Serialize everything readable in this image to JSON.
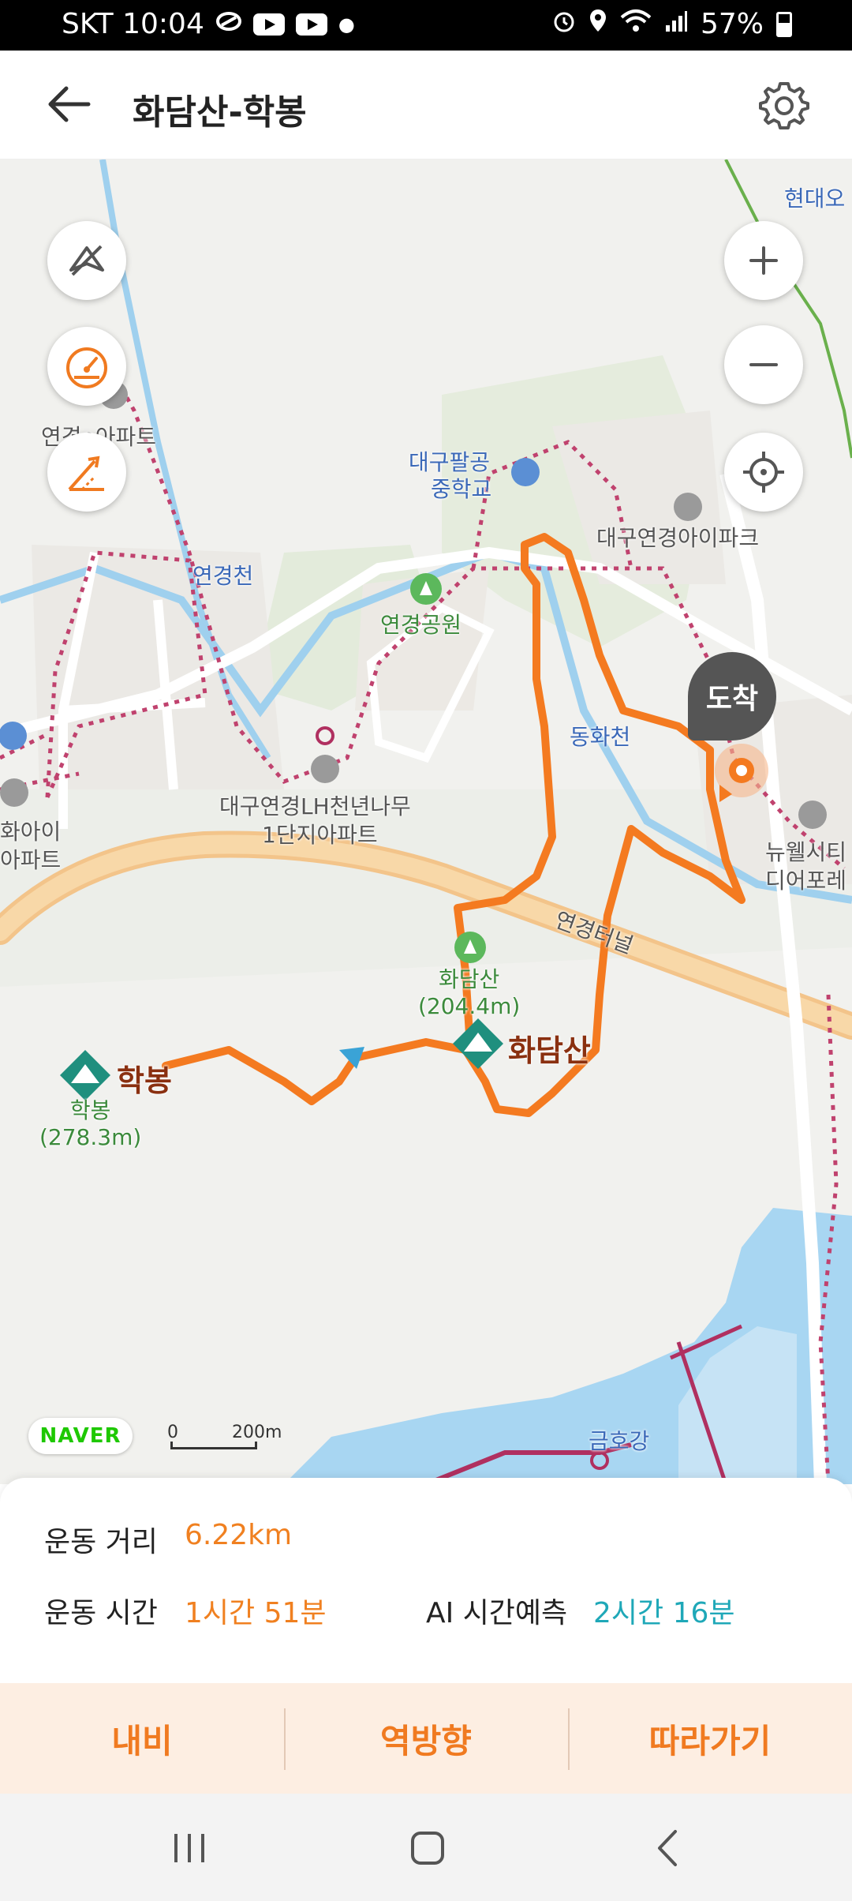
{
  "status_bar": {
    "carrier_time": "SKT 10:04",
    "battery": "57%",
    "icons": [
      "activity-icon",
      "youtube-icon",
      "youtube-icon",
      "dot-icon",
      "alarm-icon",
      "location-icon",
      "wifi-icon",
      "signal-icon",
      "battery-icon"
    ]
  },
  "header": {
    "title": "화담산-학봉",
    "back_icon": "arrow-left-icon",
    "settings_icon": "gear-icon"
  },
  "map": {
    "controls": {
      "left": [
        "route-off-icon",
        "speedometer-icon",
        "elevation-icon"
      ],
      "right": [
        "zoom-in-icon",
        "zoom-out-icon",
        "locate-icon"
      ]
    },
    "labels": {
      "hyundai": "현대오",
      "apt_left": "연경e아파트",
      "daegu_middle_1": "대구팔공",
      "daegu_middle_2": "중학교",
      "ipark": "대구연경아이파크",
      "yeongyeongcheon": "연경천",
      "park": "연경공원",
      "donghwacheon": "동화천",
      "lh_apt_1": "대구연경LH천년나무",
      "lh_apt_2": "1단지아파트",
      "left_apt_1": "화아이",
      "left_apt_2": "아파트",
      "newell_1": "뉴웰시티",
      "newell_2": "디어포레",
      "tunnel": "연경터널",
      "hwadamsan_small": "화담산",
      "hwadamsan_elev": "(204.4m)",
      "hwadamsan_peak": "화담산",
      "hakbong_peak": "학봉",
      "hakbong_small": "학봉",
      "hakbong_elev": "(278.3m)",
      "geumho": "금호강"
    },
    "arrival": "도착",
    "logo": "NAVER",
    "scale": {
      "zero": "0",
      "dist": "200m"
    },
    "route_color": "#f47a20"
  },
  "summary": {
    "distance_label": "운동 거리",
    "distance_value": "6.22km",
    "time_label": "운동 시간",
    "time_value": "1시간 51분",
    "ai_label": "AI 시간예측",
    "ai_value": "2시간 16분"
  },
  "actions": {
    "navi": "내비",
    "reverse": "역방향",
    "follow": "따라가기"
  },
  "nav_bar": {
    "icons": [
      "recent-apps-icon",
      "home-icon",
      "back-icon"
    ]
  },
  "colors": {
    "accent": "#f07a20",
    "teal": "#1fa8b8",
    "action_bg": "#fdeee2"
  }
}
